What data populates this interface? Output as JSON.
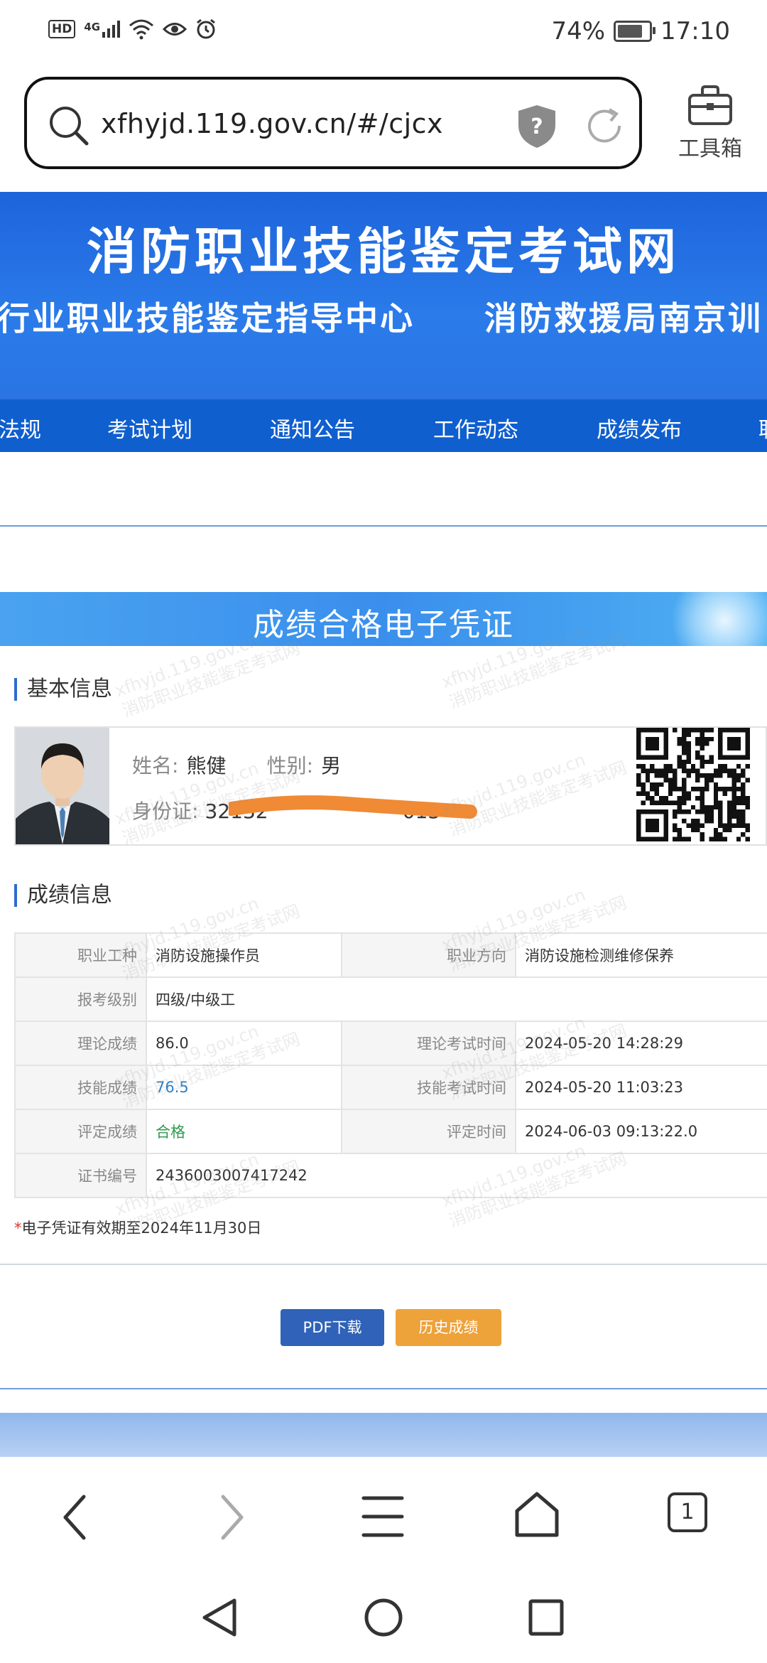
{
  "status_bar": {
    "hd": "HD",
    "network": "4G",
    "battery": "74%",
    "time": "17:10"
  },
  "browser": {
    "url": "xfhyjd.119.gov.cn/#/cjcx",
    "toolbox_label": "工具箱"
  },
  "banner": {
    "title": "消防职业技能鉴定考试网",
    "sub_left": "行业职业技能鉴定指导中心",
    "sub_right": "消防救援局南京训"
  },
  "nav": {
    "items": [
      "法规",
      "考试计划",
      "通知公告",
      "工作动态",
      "成绩发布",
      "职"
    ]
  },
  "certificate": {
    "title": "成绩合格电子凭证"
  },
  "basic_info": {
    "section_title": "基本信息",
    "name_label": "姓名:",
    "name": "熊健",
    "gender_label": "性别:",
    "gender": "男",
    "id_label": "身份证:",
    "id_prefix": "32132",
    "id_suffix": "013"
  },
  "score_info": {
    "section_title": "成绩信息",
    "rows": [
      {
        "l1": "职业工种",
        "v1": "消防设施操作员",
        "l2": "职业方向",
        "v2": "消防设施检测维修保养"
      },
      {
        "l1": "报考级别",
        "v1": "四级/中级工"
      },
      {
        "l1": "理论成绩",
        "v1": "86.0",
        "l2": "理论考试时间",
        "v2": "2024-05-20 14:28:29"
      },
      {
        "l1": "技能成绩",
        "v1": "76.5",
        "l2": "技能考试时间",
        "v2": "2024-05-20 11:03:23"
      },
      {
        "l1": "评定成绩",
        "v1": "合格",
        "l2": "评定时间",
        "v2": "2024-06-03 09:13:22.0"
      },
      {
        "l1": "证书编号",
        "v1": "2436003007417242"
      }
    ]
  },
  "validity_note": {
    "star": "*",
    "text": "电子凭证有效期至2024年11月30日"
  },
  "buttons": {
    "pdf": "PDF下载",
    "history": "历史成绩"
  },
  "watermark": {
    "line1": "xfhyjd.119.gov.cn",
    "line2": "消防职业技能鉴定考试网"
  },
  "bottom_bar": {
    "tabs_count": "1"
  },
  "colors": {
    "banner_blue": "#1d64db",
    "nav_blue": "#0f5fcf",
    "pdf_button": "#2f62b8",
    "history_button": "#eea23a",
    "pass_green": "#2e9a4f"
  }
}
